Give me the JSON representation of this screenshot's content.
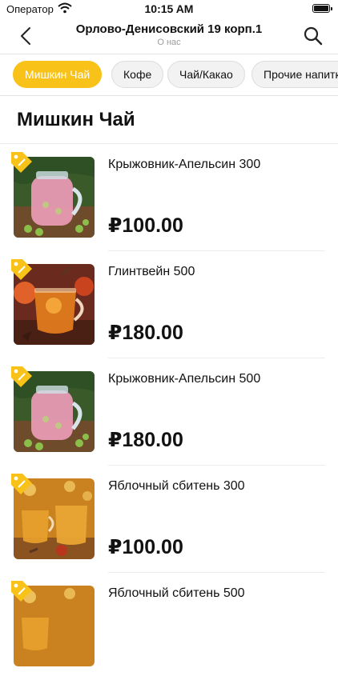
{
  "status": {
    "carrier": "Оператор",
    "time": "10:15 AM"
  },
  "nav": {
    "title": "Орлово-Денисовский 19 корп.1",
    "subtitle": "О нас"
  },
  "categories": [
    "Мишкин Чай",
    "Кофе",
    "Чай/Какао",
    "Прочие напитки"
  ],
  "active_category": "Мишкин Чай",
  "section": {
    "title": "Мишкин Чай"
  },
  "items": [
    {
      "name": "Крыжовник-Апельсин 300",
      "price": "₽100.00",
      "image": "gooseberry-drink"
    },
    {
      "name": "Глинтвейн 500",
      "price": "₽180.00",
      "image": "mulled-wine"
    },
    {
      "name": "Крыжовник-Апельсин 500",
      "price": "₽180.00",
      "image": "gooseberry-drink"
    },
    {
      "name": "Яблочный сбитень 300",
      "price": "₽100.00",
      "image": "apple-sbiten"
    },
    {
      "name": "Яблочный сбитень 500",
      "price": "",
      "image": "apple-sbiten"
    }
  ],
  "theme": {
    "accent": "#f8c218"
  }
}
